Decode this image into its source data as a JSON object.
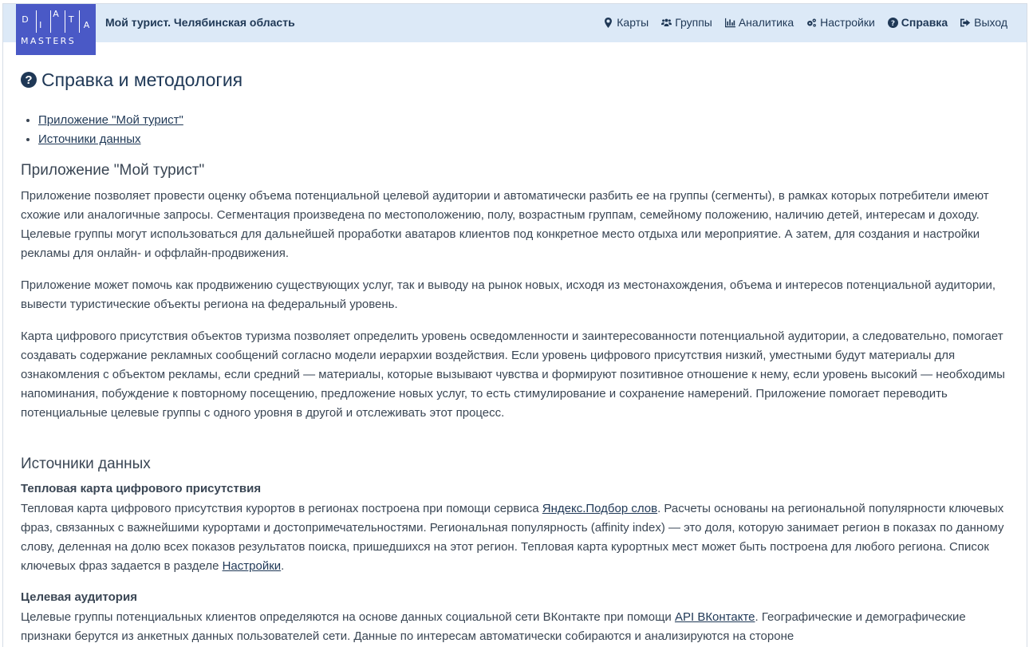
{
  "logo": {
    "row1": [
      "D",
      "I",
      "A",
      "T",
      "A"
    ],
    "row2": "MASTERS"
  },
  "header": {
    "brand": "Мой турист. Челябинская область",
    "nav": [
      {
        "label": "Карты",
        "icon": "map-marker-icon"
      },
      {
        "label": "Группы",
        "icon": "users-icon"
      },
      {
        "label": "Аналитика",
        "icon": "bar-chart-icon"
      },
      {
        "label": "Настройки",
        "icon": "cogs-icon"
      },
      {
        "label": "Справка",
        "icon": "question-circle-icon",
        "active": true
      },
      {
        "label": "Выход",
        "icon": "sign-out-icon"
      }
    ]
  },
  "page": {
    "title": "Справка и методология",
    "toc": [
      "Приложение \"Мой турист\"",
      "Источники данных"
    ]
  },
  "section1": {
    "heading": "Приложение \"Мой турист\"",
    "p1": "Приложение позволяет провести оценку объема потенциальной целевой аудитории и автоматически разбить ее на группы (сегменты), в рамках которых потребители имеют схожие или аналогичные запросы. Сегментация произведена по местоположению, полу, возрастным группам, семейному положению, наличию детей, интересам и доходу. Целевые группы могут использоваться для дальнейшей проработки аватаров клиентов под конкретное место отдыха или мероприятие. А затем, для создания и настройки рекламы для онлайн- и оффлайн-продвижения.",
    "p2": "Приложение может помочь как продвижению существующих услуг, так и выводу на рынок новых, исходя из местонахождения, объема и интересов потенциальной аудитории, вывести туристические объекты региона на федеральный уровень.",
    "p3": "Карта цифрового присутствия объектов туризма позволяет определить уровень осведомленности и заинтересованности потенциальной аудитории, а следовательно, помогает создавать содержание рекламных сообщений согласно модели иерархии воздействия. Если уровень цифрового присутствия низкий, уместными будут материалы для ознакомления с объектом рекламы, если средний — материалы, которые вызывают чувства и формируют позитивное отношение к нему, если уровень высокий — необходимы напоминания, побуждение к повторному посещению, предложение новых услуг, то есть стимулирование и сохранение намерений. Приложение помогает переводить потенциальные целевые группы с одного уровня в другой и отслеживать этот процесс."
  },
  "section2": {
    "heading": "Источники данных",
    "heatmap": {
      "title": "Тепловая карта цифрового присутствия",
      "text_before": "Тепловая карта цифрового присутствия курортов в регионах построена при помощи сервиса ",
      "link1": "Яндекс.Подбор слов",
      "text_middle": ". Расчеты основаны на региональной популярности ключевых фраз, связанных с важнейшими курортами и достопримечательностями. Региональная популярность (affinity index) — это доля, которую занимает регион в показах по данному слову, деленная на долю всех показов результатов поиска, пришедшихся на этот регион. Тепловая карта курортных мест может быть построена для любого региона. Список ключевых фраз задается в разделе ",
      "link2": "Настройки",
      "text_after": "."
    },
    "audience": {
      "title": "Целевая аудитория",
      "text_before": "Целевые группы потенциальных клиентов определяются на основе данных социальной сети ВКонтакте при помощи ",
      "link1": "API ВКонтакте",
      "text_after": ". Географические и демографические признаки берутся из анкетных данных пользователей сети. Данные по интересам автоматически собираются и анализируются на стороне"
    }
  }
}
